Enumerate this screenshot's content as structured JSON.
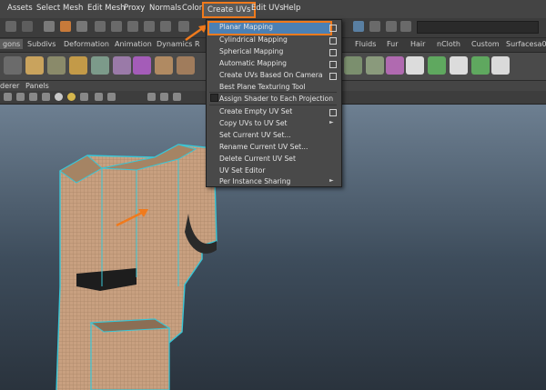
{
  "menubar": {
    "items": [
      "Assets",
      "Select",
      "Mesh",
      "Edit Mesh",
      "Proxy",
      "Normals",
      "Color",
      "Create UVs",
      "Edit UVs",
      "Help"
    ]
  },
  "shelf": {
    "tabs": [
      "gons",
      "Subdivs",
      "Deformation",
      "Animation",
      "Dynamics",
      "R",
      "Fluids",
      "Fur",
      "Hair",
      "nCloth",
      "Custom",
      "Surfacesa03"
    ]
  },
  "panel_menu": {
    "items": [
      "derer",
      "Panels"
    ]
  },
  "create_uvs_menu": {
    "items": [
      "Planar Mapping",
      "Cylindrical Mapping",
      "Spherical Mapping",
      "Automatic Mapping",
      "Create UVs Based On Camera",
      "Best Plane Texturing Tool",
      "Assign Shader to Each Projection",
      "Create Empty UV Set",
      "Copy UVs to UV Set",
      "Set Current UV Set...",
      "Rename Current UV Set...",
      "Delete Current UV Set",
      "UV Set Editor",
      "Per Instance Sharing"
    ],
    "highlighted": "Planar Mapping"
  },
  "colors": {
    "highlight": "#f07a1c",
    "selection": "#4b80b4",
    "mesh": "#c8a080",
    "wire": "#39c6d6"
  },
  "icons": [
    "select-arrow-icon",
    "lasso-icon",
    "paint-icon",
    "move-icon",
    "rotate-icon",
    "scale-icon",
    "magnet-icon",
    "render-icon",
    "cube-icon",
    "sphere-icon",
    "checker-icon"
  ]
}
